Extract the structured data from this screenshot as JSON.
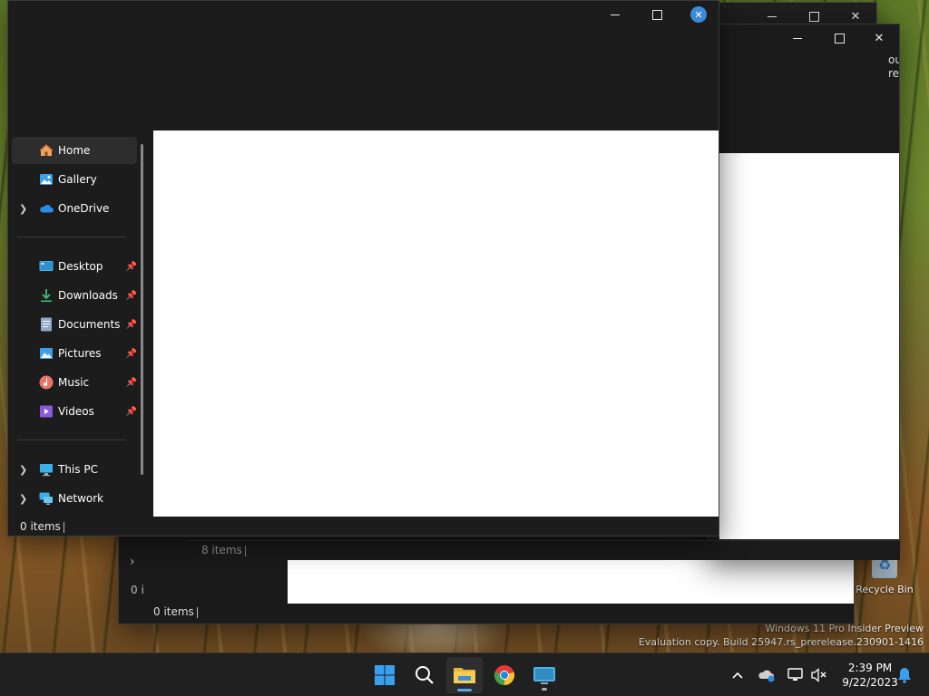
{
  "nav": {
    "items": [
      {
        "label": "Home",
        "icon": "home-icon"
      },
      {
        "label": "Gallery",
        "icon": "gallery-icon"
      },
      {
        "label": "OneDrive",
        "icon": "onedrive-icon"
      },
      {
        "label": "Desktop",
        "icon": "desktop-folder-icon"
      },
      {
        "label": "Downloads",
        "icon": "downloads-icon"
      },
      {
        "label": "Documents",
        "icon": "documents-icon"
      },
      {
        "label": "Pictures",
        "icon": "pictures-icon"
      },
      {
        "label": "Music",
        "icon": "music-icon"
      },
      {
        "label": "Videos",
        "icon": "videos-icon"
      },
      {
        "label": "This PC",
        "icon": "this-pc-icon"
      },
      {
        "label": "Network",
        "icon": "network-icon"
      }
    ]
  },
  "main_window": {
    "status": "0 items"
  },
  "middle_window": {
    "status": "8 items",
    "peek_text_1": "out",
    "peek_text_2": "re"
  },
  "back_window": {
    "status": "0 items",
    "truncated_status": "0 i"
  },
  "desktop": {
    "recycle_bin_label": "Recycle Bin",
    "watermark_line1": "Windows 11 Pro Insider Preview",
    "watermark_line2": "Evaluation copy. Build 25947.rs_prerelease.230901-1416"
  },
  "taskbar": {
    "time": "2:39 PM",
    "date": "9/22/2023"
  },
  "colors": {
    "accent": "#3b8bd8",
    "window_bg": "#1c1c1c",
    "taskbar_bg": "#202020"
  }
}
